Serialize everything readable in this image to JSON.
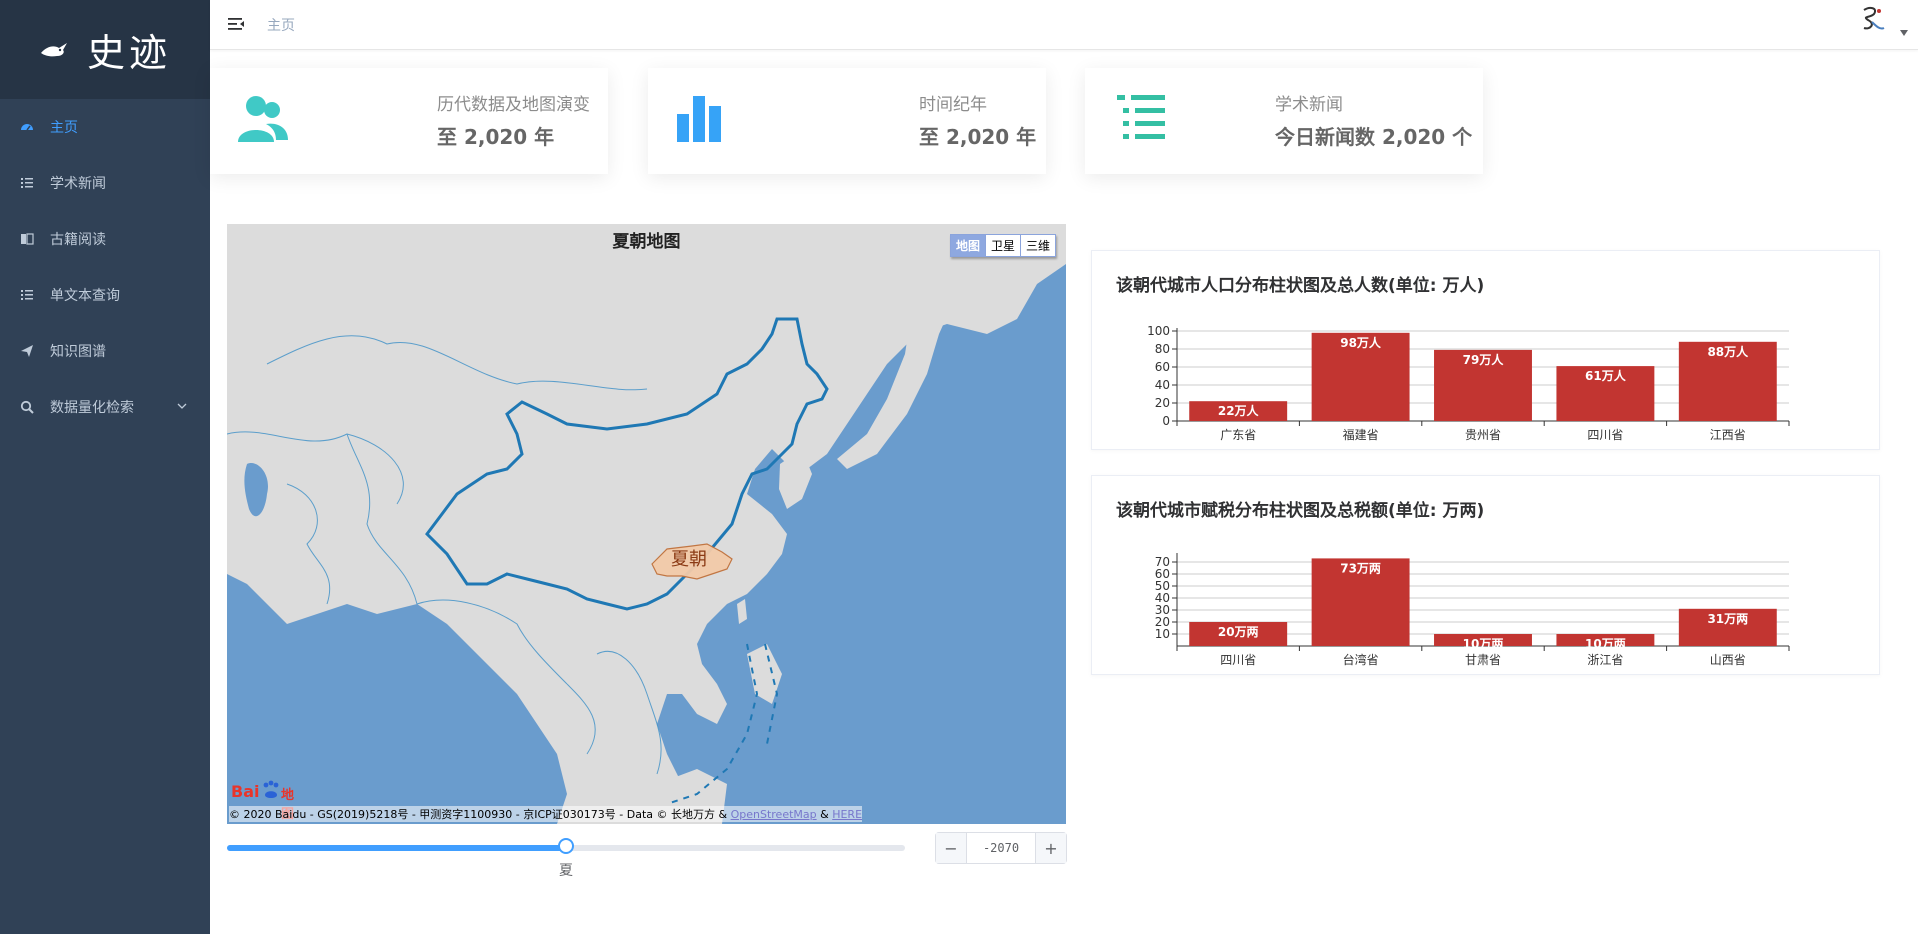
{
  "app": {
    "logo_text": "史迹"
  },
  "sidebar": {
    "items": [
      {
        "label": "主页",
        "icon": "dashboard-icon",
        "active": true
      },
      {
        "label": "学术新闻",
        "icon": "list-icon",
        "active": false
      },
      {
        "label": "古籍阅读",
        "icon": "book-icon",
        "active": false
      },
      {
        "label": "单文本查询",
        "icon": "list-icon",
        "active": false
      },
      {
        "label": "知识图谱",
        "icon": "paper-plane-icon",
        "active": false
      },
      {
        "label": "数据量化检索",
        "icon": "search-icon",
        "active": false,
        "expandable": true
      }
    ]
  },
  "header": {
    "breadcrumb": "主页"
  },
  "stats": [
    {
      "label": "历代数据及地图演变",
      "value": "至 2,020 年",
      "icon": "people-icon",
      "color": "#40c9c6"
    },
    {
      "label": "时间纪年",
      "value": "至 2,020 年",
      "icon": "bar-chart-icon",
      "color": "#36a3f7"
    },
    {
      "label": "学术新闻",
      "value": "今日新闻数 2,020 个",
      "icon": "list-icon",
      "color": "#34bfa3"
    }
  ],
  "map": {
    "title": "夏朝地图",
    "region_label": "夏朝",
    "type_buttons": [
      "地图",
      "卫星",
      "三维"
    ],
    "active_type": "地图",
    "copyright_text": "© 2020 Baidu - GS(2019)5218号 - 甲测资字1100930 - 京ICP证030173号 - Data © 长地万方 & ",
    "copyright_link1": "OpenStreetMap",
    "copyright_amp": " & ",
    "copyright_link2": "HERE",
    "logo_text_latin": "Bai",
    "logo_text_cn": "地图"
  },
  "timeline": {
    "mark_label": "夏",
    "progress": 0.5,
    "stepper_value": "-2070",
    "minus": "−",
    "plus": "+"
  },
  "colors": {
    "sidebar_bg": "#304156",
    "accent": "#409eff",
    "bar": "#c23531"
  },
  "chart_data": [
    {
      "type": "bar",
      "title": "该朝代城市人口分布柱状图及总人数(单位: 万人)",
      "categories": [
        "广东省",
        "福建省",
        "贵州省",
        "四川省",
        "江西省"
      ],
      "values": [
        22,
        98,
        79,
        61,
        88
      ],
      "labels": [
        "22万人",
        "98万人",
        "79万人",
        "61万人",
        "88万人"
      ],
      "yticks": [
        0,
        20,
        40,
        60,
        80,
        100
      ],
      "ylim": [
        0,
        100
      ],
      "grid": true
    },
    {
      "type": "bar",
      "title": "该朝代城市赋税分布柱状图及总税额(单位: 万两)",
      "categories": [
        "四川省",
        "台湾省",
        "甘肃省",
        "浙江省",
        "山西省"
      ],
      "values": [
        20,
        73,
        10,
        10,
        31
      ],
      "labels": [
        "20万两",
        "73万两",
        "10万两",
        "10万两",
        "31万两"
      ],
      "yticks": [
        10,
        20,
        30,
        40,
        50,
        60,
        70
      ],
      "ylim": [
        0,
        75
      ],
      "grid": true
    }
  ]
}
